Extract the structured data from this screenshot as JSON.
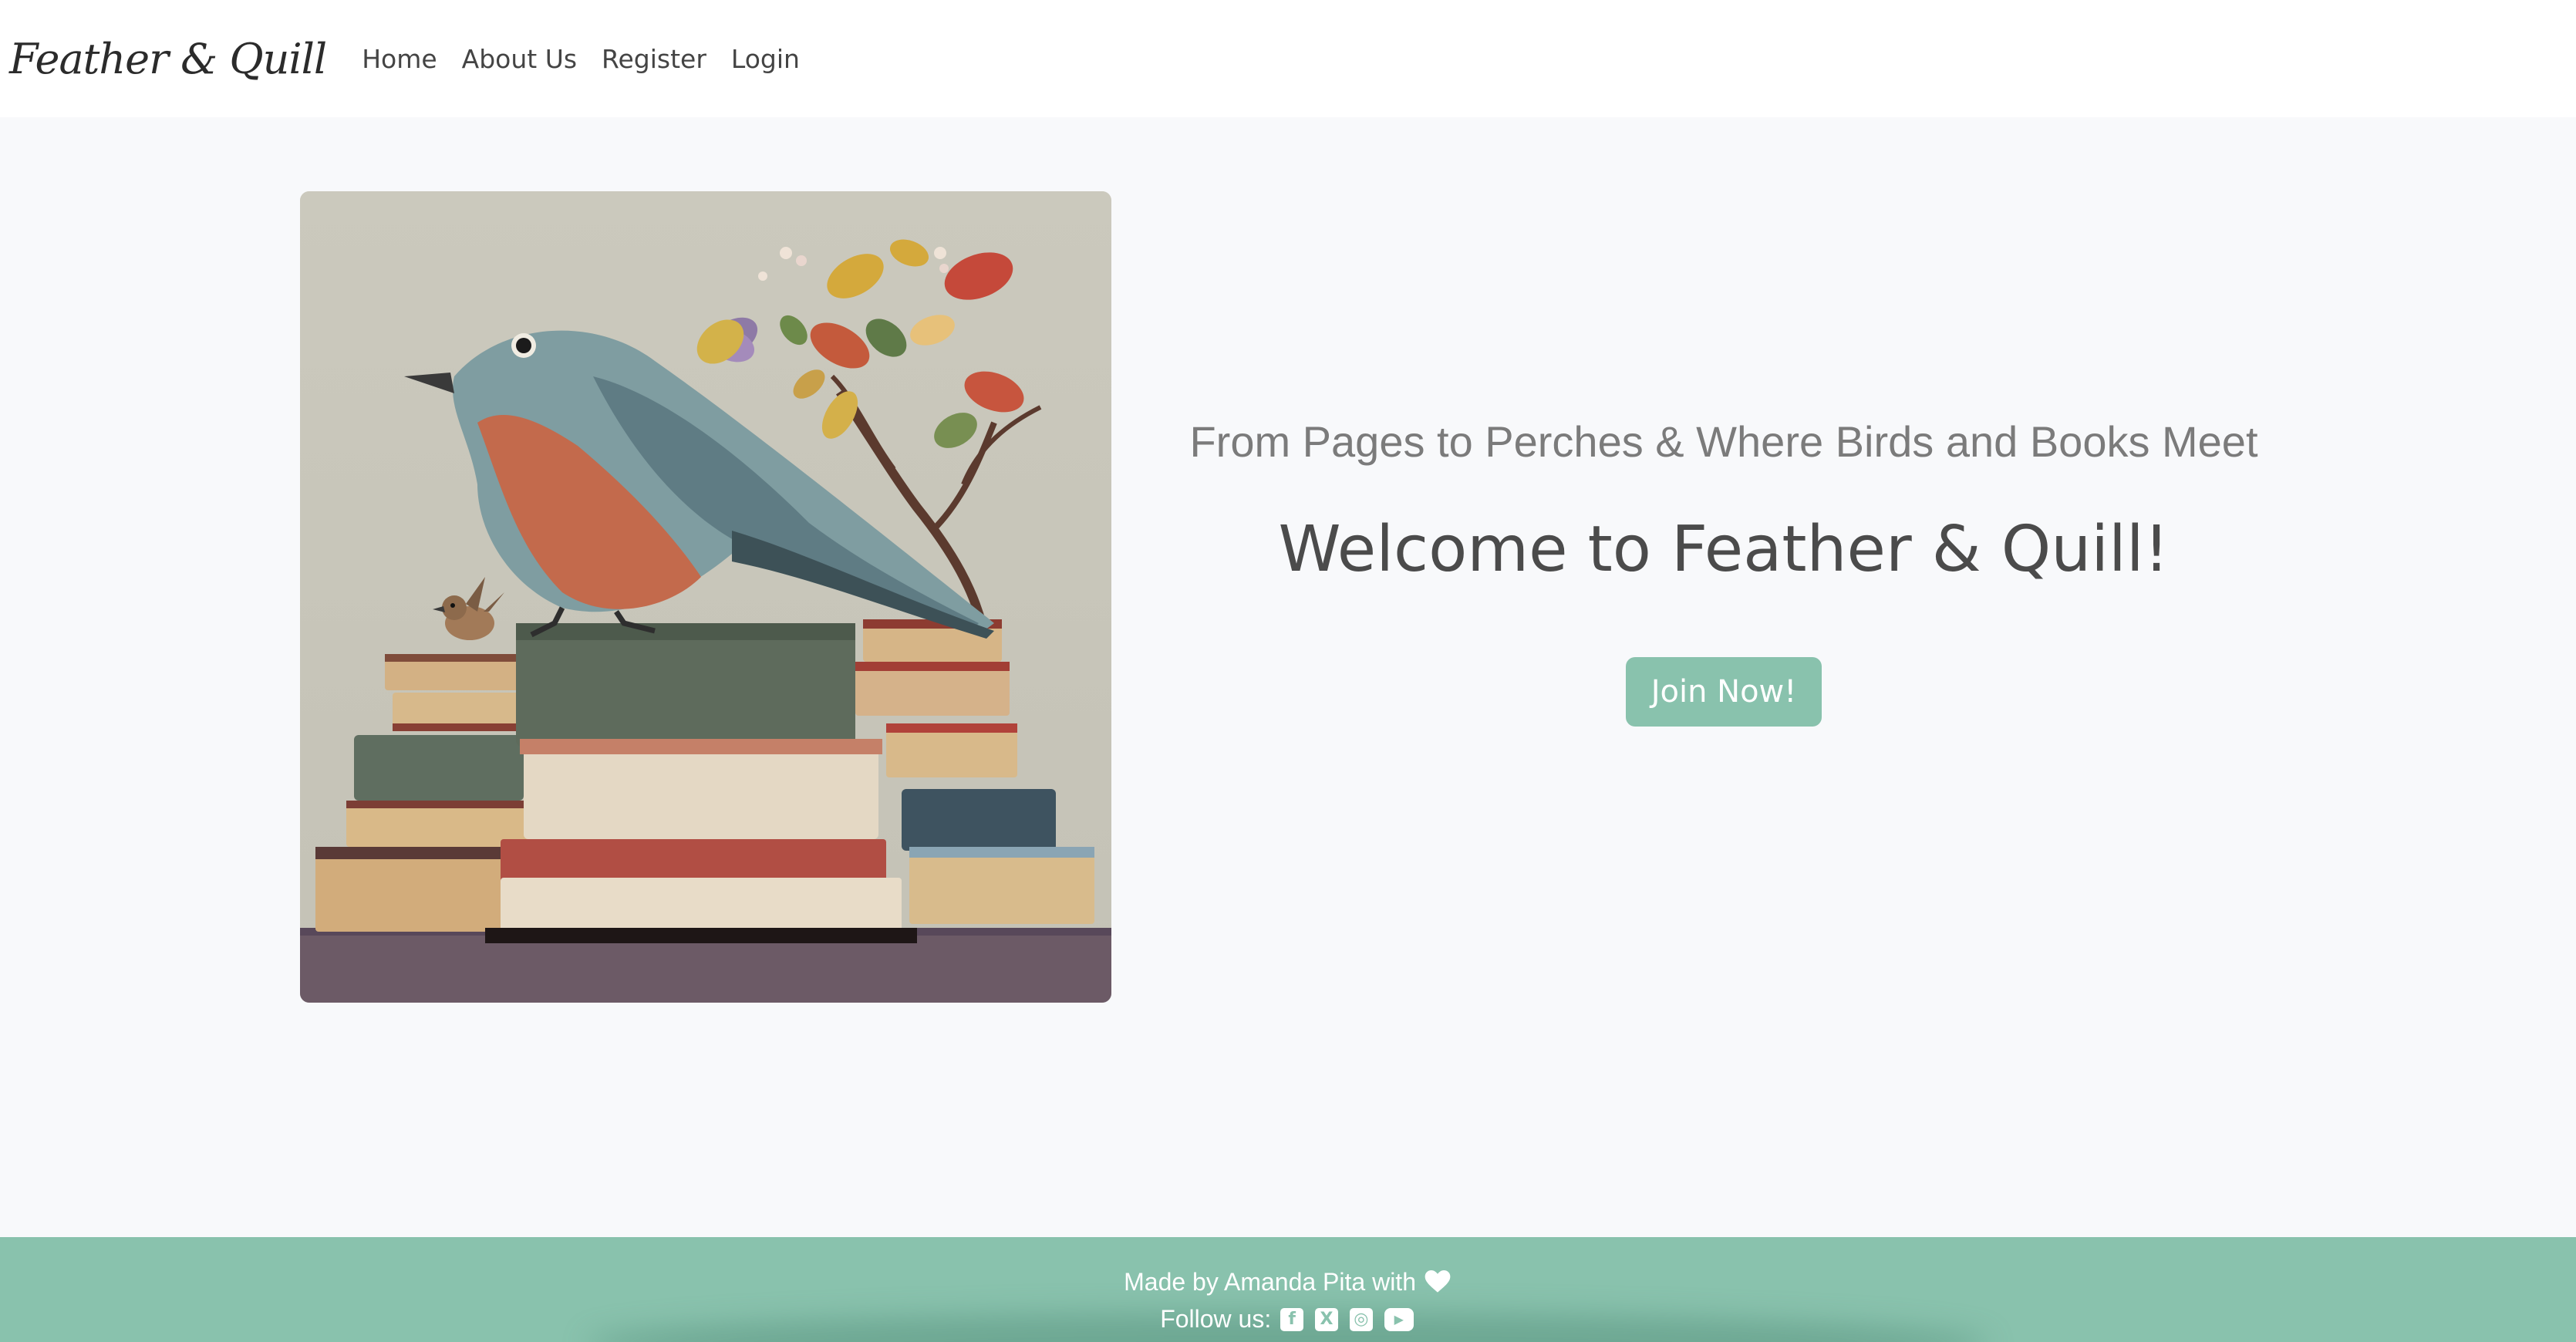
{
  "navbar": {
    "brand": "Feather & Quill",
    "links": [
      "Home",
      "About Us",
      "Register",
      "Login"
    ]
  },
  "hero": {
    "image_icon": "bird-on-books-illustration",
    "tagline": "From Pages to Perches & Where Birds and Books Meet",
    "welcome": "Welcome to Feather & Quill!",
    "cta_label": "Join Now!"
  },
  "footer": {
    "made_by": "Made by Amanda Pita with",
    "heart_icon": "heart-icon",
    "follow_label": "Follow us:",
    "social": [
      {
        "icon": "facebook-icon",
        "glyph": "f"
      },
      {
        "icon": "x-icon",
        "glyph": "X"
      },
      {
        "icon": "instagram-icon",
        "glyph": "◎"
      },
      {
        "icon": "youtube-icon",
        "glyph": "▶"
      }
    ]
  },
  "colors": {
    "accent": "#89c2ad",
    "page_bg": "#f8f9fb",
    "navbar_bg": "#ffffff",
    "text_dark": "#4b4b4b",
    "text_muted": "#7b7b7b"
  }
}
